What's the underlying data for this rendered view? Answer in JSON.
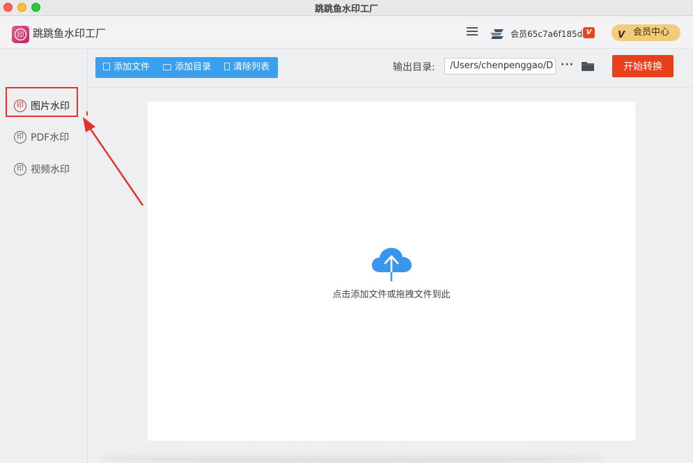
{
  "window": {
    "title": "跳跳鱼水印工厂"
  },
  "header": {
    "app_name": "跳跳鱼水印工厂",
    "user_name": "会员65c7a6f185d4",
    "vip_badge": "V",
    "member_center_label": "会员中心",
    "member_center_mark": "V",
    "logo_glyph": "印"
  },
  "sidebar": {
    "icon_glyph": "印",
    "items": [
      {
        "label": "图片水印",
        "active": true
      },
      {
        "label": "PDF水印",
        "active": false
      },
      {
        "label": "视频水印",
        "active": false
      }
    ]
  },
  "toolbar": {
    "add_file": "添加文件",
    "add_dir": "添加目录",
    "clear_list": "清除列表",
    "output_label": "输出目录:",
    "output_path": "/Users/chenpenggao/D",
    "more": "···",
    "start": "开始转换"
  },
  "dropzone": {
    "text": "点击添加文件或拖拽文件到此"
  },
  "colors": {
    "accent": "#3aa0ee",
    "start": "#e8401b",
    "annotation": "#e3322e",
    "vip": "#f3cc79"
  },
  "icons": [
    "traffic-lights",
    "menu-icon",
    "user-avatar-icon",
    "vip-icon",
    "seal-icon",
    "file-icon",
    "folder-icon",
    "trash-icon",
    "cloud-upload-icon"
  ]
}
